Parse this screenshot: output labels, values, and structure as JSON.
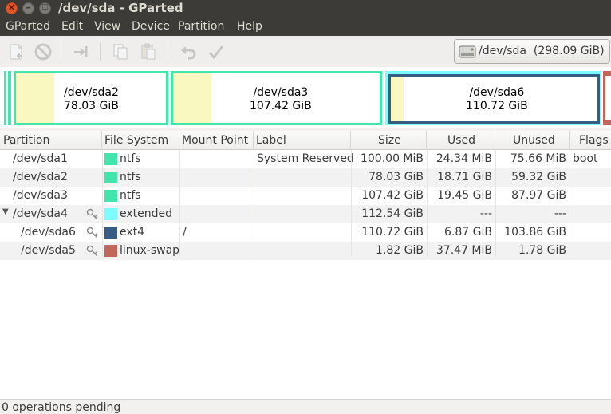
{
  "window": {
    "title": "/dev/sda - GParted"
  },
  "menubar": {
    "items": [
      "GParted",
      "Edit",
      "View",
      "Device",
      "Partition",
      "Help"
    ]
  },
  "toolbar": {
    "device": "/dev/sda",
    "device_size": "(298.09 GiB)",
    "icons": [
      "new-icon",
      "delete-icon",
      "resize-move-icon",
      "copy-icon",
      "paste-icon",
      "undo-icon",
      "apply-icon"
    ]
  },
  "visual_map": {
    "partitions": [
      {
        "name": "/dev/sda2",
        "size": "78.03 GiB",
        "color": "#42e5ac"
      },
      {
        "name": "/dev/sda3",
        "size": "107.42 GiB",
        "color": "#42e5ac"
      },
      {
        "name": "/dev/sda6",
        "size": "110.72 GiB",
        "color": "#385d82"
      }
    ],
    "colors": {
      "ntfs": "#42e5ac",
      "extended": "#7dfcfe",
      "ext4": "#385d82",
      "swap": "#c1665a",
      "used": "#f8f8c0"
    }
  },
  "table": {
    "headers": [
      "Partition",
      "File System",
      "Mount Point",
      "Label",
      "Size",
      "Used",
      "Unused",
      "Flags"
    ],
    "rows": [
      {
        "partition": "/dev/sda1",
        "fs": "ntfs",
        "fs_color": "#42e5ac",
        "mount": "",
        "label": "System Reserved",
        "size": "100.00 MiB",
        "used": "24.34 MiB",
        "unused": "75.66 MiB",
        "flags": "boot",
        "key": false
      },
      {
        "partition": "/dev/sda2",
        "fs": "ntfs",
        "fs_color": "#42e5ac",
        "mount": "",
        "label": "",
        "size": "78.03 GiB",
        "used": "18.71 GiB",
        "unused": "59.32 GiB",
        "flags": "",
        "key": false
      },
      {
        "partition": "/dev/sda3",
        "fs": "ntfs",
        "fs_color": "#42e5ac",
        "mount": "",
        "label": "",
        "size": "107.42 GiB",
        "used": "19.45 GiB",
        "unused": "87.97 GiB",
        "flags": "",
        "key": false
      },
      {
        "partition": "/dev/sda4",
        "fs": "extended",
        "fs_color": "#7dfcfe",
        "mount": "",
        "label": "",
        "size": "112.54 GiB",
        "used": "---",
        "unused": "---",
        "flags": "",
        "key": true
      },
      {
        "partition": "/dev/sda6",
        "fs": "ext4",
        "fs_color": "#385d82",
        "mount": "/",
        "label": "",
        "size": "110.72 GiB",
        "used": "6.87 GiB",
        "unused": "103.86 GiB",
        "flags": "",
        "key": true
      },
      {
        "partition": "/dev/sda5",
        "fs": "linux-swap",
        "fs_color": "#c1665a",
        "mount": "",
        "label": "",
        "size": "1.82 GiB",
        "used": "37.47 MiB",
        "unused": "1.78 GiB",
        "flags": "",
        "key": true
      }
    ]
  },
  "status": {
    "text": "0 operations pending"
  }
}
